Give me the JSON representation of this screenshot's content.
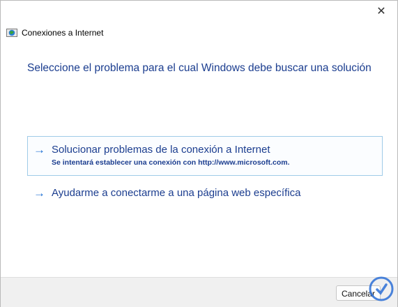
{
  "window": {
    "title": "Conexiones a Internet",
    "close_glyph": "✕"
  },
  "heading": "Seleccione el problema para el cual Windows debe buscar una solución",
  "options": [
    {
      "arrow": "→",
      "title": "Solucionar problemas de la conexión a Internet",
      "description": "Se intentará establecer una conexión con http://www.microsoft.com."
    },
    {
      "arrow": "→",
      "title": "Ayudarme a conectarme a una página web específica"
    }
  ],
  "footer": {
    "cancel_label": "Cancelar"
  },
  "colors": {
    "heading": "#1b3d8f",
    "arrow": "#1c6fd3",
    "selection_border": "#9fcbe8"
  },
  "icons": {
    "app": "network-globe-icon",
    "close": "close-icon",
    "watermark": "brand-logo"
  }
}
